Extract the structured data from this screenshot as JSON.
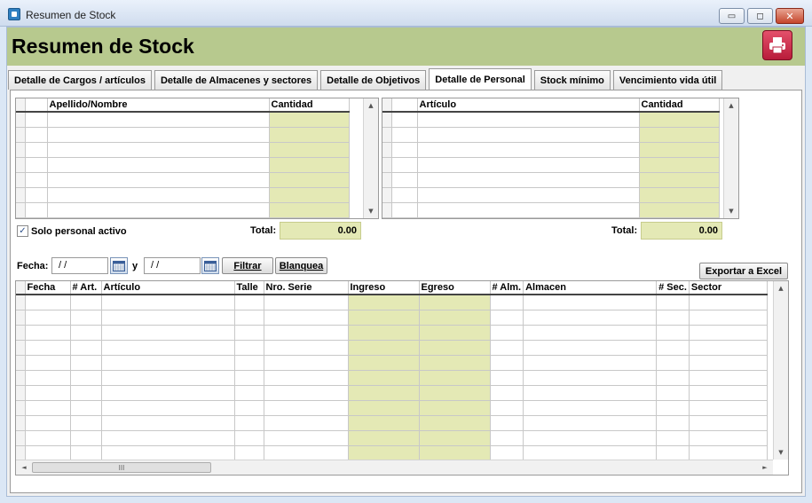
{
  "window": {
    "title": "Resumen de Stock",
    "min": "▭",
    "max": "◻",
    "close": "✕"
  },
  "header": {
    "title": "Resumen de Stock"
  },
  "tabs": [
    "Detalle de Cargos / artículos",
    "Detalle de Almacenes y sectores",
    "Detalle de Objetivos",
    "Detalle de Personal",
    "Stock mínimo",
    "Vencimiento vida útil"
  ],
  "active_tab": 3,
  "personal_grid": {
    "columns": [
      "Apellido/Nombre",
      "Cantidad"
    ],
    "rows": 7
  },
  "articulo_grid": {
    "columns": [
      "Artículo",
      "Cantidad"
    ],
    "rows": 7
  },
  "solo_activo": {
    "label": "Solo personal activo",
    "checked": true,
    "mark": "✓"
  },
  "totals": {
    "label": "Total:",
    "left": "0.00",
    "right": "0.00"
  },
  "filter": {
    "fecha_label": "Fecha:",
    "y_label": "y",
    "date_from": " / /",
    "date_to": " / /",
    "filtrar": "Filtrar",
    "blanquea": "Blanquea",
    "exportar": "Exportar a Excel"
  },
  "movements_grid": {
    "columns": [
      "Fecha",
      "# Art.",
      "Artículo",
      "Talle",
      "Nro. Serie",
      "Ingreso",
      "Egreso",
      "# Alm.",
      "Almacen",
      "# Sec.",
      "Sector"
    ],
    "rows": 11,
    "scroll_grip": "III"
  },
  "scroll": {
    "up": "▲",
    "down": "▼",
    "left": "◄",
    "right": "►"
  },
  "colors": {
    "header_band": "#b7c98e",
    "numeric_cell": "#e4e9b5",
    "print_button": "#c8203f"
  }
}
